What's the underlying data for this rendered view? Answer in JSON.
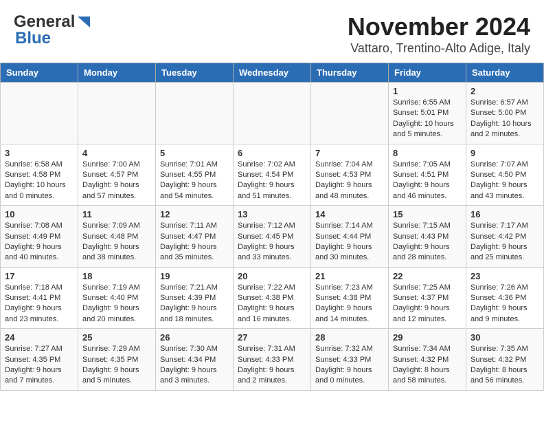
{
  "header": {
    "logo_line1": "General",
    "logo_line2": "Blue",
    "title": "November 2024",
    "subtitle": "Vattaro, Trentino-Alto Adige, Italy"
  },
  "weekdays": [
    "Sunday",
    "Monday",
    "Tuesday",
    "Wednesday",
    "Thursday",
    "Friday",
    "Saturday"
  ],
  "weeks": [
    [
      {
        "day": "",
        "info": ""
      },
      {
        "day": "",
        "info": ""
      },
      {
        "day": "",
        "info": ""
      },
      {
        "day": "",
        "info": ""
      },
      {
        "day": "",
        "info": ""
      },
      {
        "day": "1",
        "info": "Sunrise: 6:55 AM\nSunset: 5:01 PM\nDaylight: 10 hours and 5 minutes."
      },
      {
        "day": "2",
        "info": "Sunrise: 6:57 AM\nSunset: 5:00 PM\nDaylight: 10 hours and 2 minutes."
      }
    ],
    [
      {
        "day": "3",
        "info": "Sunrise: 6:58 AM\nSunset: 4:58 PM\nDaylight: 10 hours and 0 minutes."
      },
      {
        "day": "4",
        "info": "Sunrise: 7:00 AM\nSunset: 4:57 PM\nDaylight: 9 hours and 57 minutes."
      },
      {
        "day": "5",
        "info": "Sunrise: 7:01 AM\nSunset: 4:55 PM\nDaylight: 9 hours and 54 minutes."
      },
      {
        "day": "6",
        "info": "Sunrise: 7:02 AM\nSunset: 4:54 PM\nDaylight: 9 hours and 51 minutes."
      },
      {
        "day": "7",
        "info": "Sunrise: 7:04 AM\nSunset: 4:53 PM\nDaylight: 9 hours and 48 minutes."
      },
      {
        "day": "8",
        "info": "Sunrise: 7:05 AM\nSunset: 4:51 PM\nDaylight: 9 hours and 46 minutes."
      },
      {
        "day": "9",
        "info": "Sunrise: 7:07 AM\nSunset: 4:50 PM\nDaylight: 9 hours and 43 minutes."
      }
    ],
    [
      {
        "day": "10",
        "info": "Sunrise: 7:08 AM\nSunset: 4:49 PM\nDaylight: 9 hours and 40 minutes."
      },
      {
        "day": "11",
        "info": "Sunrise: 7:09 AM\nSunset: 4:48 PM\nDaylight: 9 hours and 38 minutes."
      },
      {
        "day": "12",
        "info": "Sunrise: 7:11 AM\nSunset: 4:47 PM\nDaylight: 9 hours and 35 minutes."
      },
      {
        "day": "13",
        "info": "Sunrise: 7:12 AM\nSunset: 4:45 PM\nDaylight: 9 hours and 33 minutes."
      },
      {
        "day": "14",
        "info": "Sunrise: 7:14 AM\nSunset: 4:44 PM\nDaylight: 9 hours and 30 minutes."
      },
      {
        "day": "15",
        "info": "Sunrise: 7:15 AM\nSunset: 4:43 PM\nDaylight: 9 hours and 28 minutes."
      },
      {
        "day": "16",
        "info": "Sunrise: 7:17 AM\nSunset: 4:42 PM\nDaylight: 9 hours and 25 minutes."
      }
    ],
    [
      {
        "day": "17",
        "info": "Sunrise: 7:18 AM\nSunset: 4:41 PM\nDaylight: 9 hours and 23 minutes."
      },
      {
        "day": "18",
        "info": "Sunrise: 7:19 AM\nSunset: 4:40 PM\nDaylight: 9 hours and 20 minutes."
      },
      {
        "day": "19",
        "info": "Sunrise: 7:21 AM\nSunset: 4:39 PM\nDaylight: 9 hours and 18 minutes."
      },
      {
        "day": "20",
        "info": "Sunrise: 7:22 AM\nSunset: 4:38 PM\nDaylight: 9 hours and 16 minutes."
      },
      {
        "day": "21",
        "info": "Sunrise: 7:23 AM\nSunset: 4:38 PM\nDaylight: 9 hours and 14 minutes."
      },
      {
        "day": "22",
        "info": "Sunrise: 7:25 AM\nSunset: 4:37 PM\nDaylight: 9 hours and 12 minutes."
      },
      {
        "day": "23",
        "info": "Sunrise: 7:26 AM\nSunset: 4:36 PM\nDaylight: 9 hours and 9 minutes."
      }
    ],
    [
      {
        "day": "24",
        "info": "Sunrise: 7:27 AM\nSunset: 4:35 PM\nDaylight: 9 hours and 7 minutes."
      },
      {
        "day": "25",
        "info": "Sunrise: 7:29 AM\nSunset: 4:35 PM\nDaylight: 9 hours and 5 minutes."
      },
      {
        "day": "26",
        "info": "Sunrise: 7:30 AM\nSunset: 4:34 PM\nDaylight: 9 hours and 3 minutes."
      },
      {
        "day": "27",
        "info": "Sunrise: 7:31 AM\nSunset: 4:33 PM\nDaylight: 9 hours and 2 minutes."
      },
      {
        "day": "28",
        "info": "Sunrise: 7:32 AM\nSunset: 4:33 PM\nDaylight: 9 hours and 0 minutes."
      },
      {
        "day": "29",
        "info": "Sunrise: 7:34 AM\nSunset: 4:32 PM\nDaylight: 8 hours and 58 minutes."
      },
      {
        "day": "30",
        "info": "Sunrise: 7:35 AM\nSunset: 4:32 PM\nDaylight: 8 hours and 56 minutes."
      }
    ]
  ]
}
